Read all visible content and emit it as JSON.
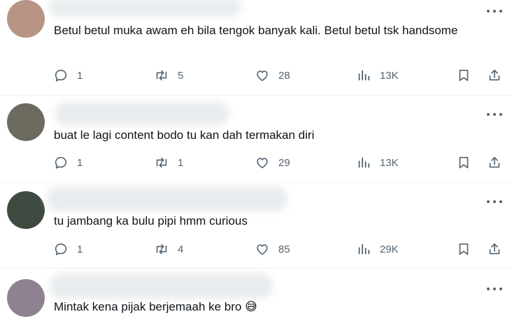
{
  "replies": [
    {
      "text": "Betul betul muka awam eh bila tengok banyak kali. Betul betul tsk handsome",
      "replies": "1",
      "reposts": "5",
      "likes": "28",
      "views": "13K",
      "avatar_color": "#b89484"
    },
    {
      "text": "buat le lagi content bodo tu kan dah termakan diri",
      "replies": "1",
      "reposts": "1",
      "likes": "29",
      "views": "13K",
      "avatar_color": "#6d6a5f"
    },
    {
      "text": "tu jambang ka bulu pipi hmm curious",
      "replies": "1",
      "reposts": "4",
      "likes": "85",
      "views": "29K",
      "avatar_color": "#3e4a40"
    },
    {
      "text": "Mintak kena pijak berjemaah ke bro",
      "emoji": "😅",
      "avatar_color": "#8e8290"
    }
  ],
  "colors": {
    "muted": "#536471",
    "text": "#0f1419",
    "divider": "#eff3f4"
  },
  "icons": [
    "reply-icon",
    "repost-icon",
    "like-icon",
    "views-icon",
    "bookmark-icon",
    "share-icon",
    "more-icon"
  ]
}
